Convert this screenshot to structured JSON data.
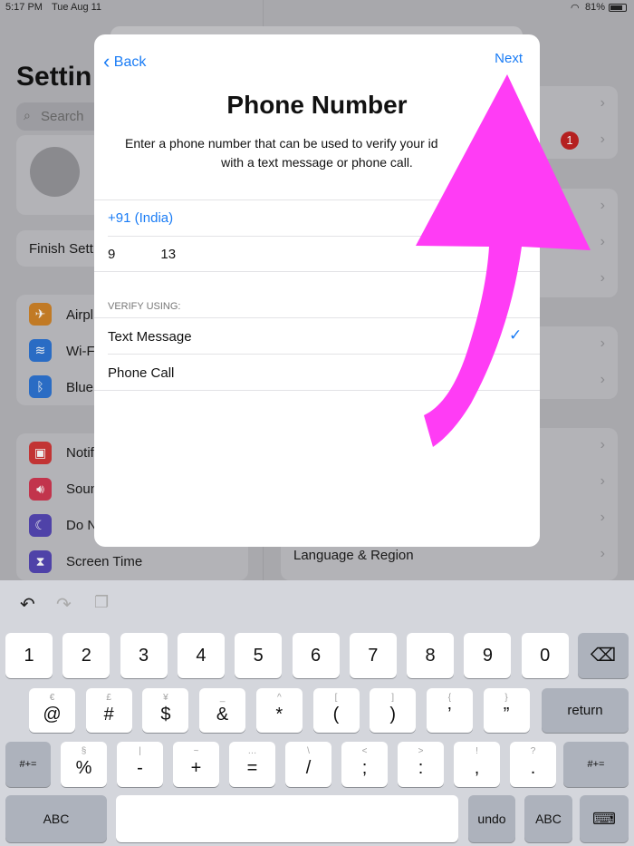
{
  "status": {
    "time": "5:17 PM",
    "date": "Tue Aug 11",
    "battery": "81%"
  },
  "sidebar": {
    "title": "Settin",
    "search_placeholder": "Search",
    "finish_setup": "Finish Sett",
    "group1": [
      "Airpl",
      "Wi-F",
      "Blue"
    ],
    "group2": [
      "Notif",
      "Soun",
      "Do N",
      "Screen Time"
    ],
    "icon_colors": [
      "#d88a2a",
      "#2a7ad8",
      "#2a7ad8",
      "#d83a3a",
      "#d83a55",
      "#5a4ac0",
      "#5a4ac0"
    ]
  },
  "right": {
    "badge": "1",
    "language_region": "Language & Region"
  },
  "modal": {
    "back": "Back",
    "next": "Next",
    "title": "Phone Number",
    "description_line1": "Enter a phone number that can be used to verify your id",
    "description_line2": "with a text message or phone call.",
    "country": "+91 (India)",
    "phone_value": "9            13",
    "verify_header": "VERIFY USING:",
    "options": [
      {
        "label": "Text Message",
        "selected": true
      },
      {
        "label": "Phone Call",
        "selected": false
      }
    ]
  },
  "annotation": {
    "color": "#ff3cf5",
    "icon": "arrow-up-icon"
  },
  "keyboard": {
    "row1": [
      "1",
      "2",
      "3",
      "4",
      "5",
      "6",
      "7",
      "8",
      "9",
      "0"
    ],
    "row2": [
      {
        "main": "@",
        "sub": "€"
      },
      {
        "main": "#",
        "sub": "£"
      },
      {
        "main": "$",
        "sub": "¥"
      },
      {
        "main": "&",
        "sub": "_"
      },
      {
        "main": "*",
        "sub": "^"
      },
      {
        "main": "(",
        "sub": "["
      },
      {
        "main": ")",
        "sub": "]"
      },
      {
        "main": "’",
        "sub": "{"
      },
      {
        "main": "”",
        "sub": "}"
      }
    ],
    "row3": [
      {
        "main": "%",
        "sub": "§"
      },
      {
        "main": "-",
        "sub": "|"
      },
      {
        "main": "+",
        "sub": "~"
      },
      {
        "main": "=",
        "sub": "…"
      },
      {
        "main": "/",
        "sub": "\\"
      },
      {
        "main": ";",
        "sub": "<"
      },
      {
        "main": ":",
        "sub": ">"
      },
      {
        "main": ",",
        "sub": "!"
      },
      {
        "main": ".",
        "sub": "?"
      }
    ],
    "return": "return",
    "symbols": "#+=",
    "abc": "ABC",
    "undo": "undo"
  }
}
